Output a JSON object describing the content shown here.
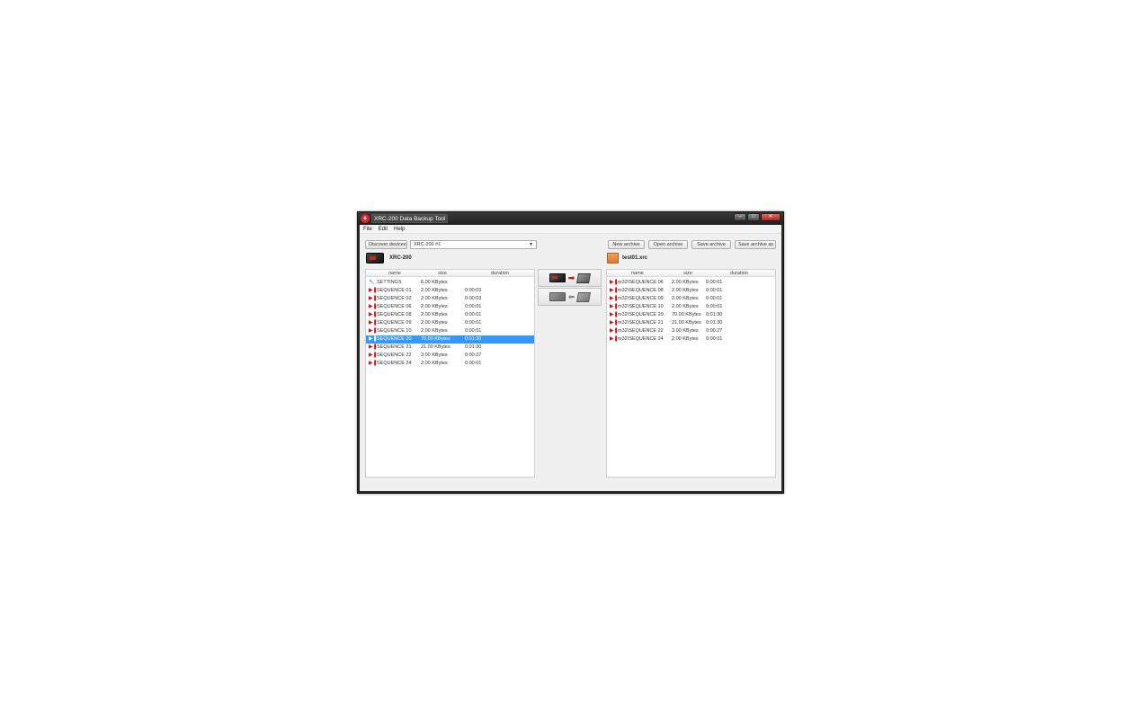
{
  "window": {
    "title": "XRC-200 Data Backup Tool",
    "controls": {
      "minimize": "–",
      "maximize": "□",
      "close": "✕"
    }
  },
  "menu": [
    "File",
    "Edit",
    "Help"
  ],
  "device": {
    "discover_label": "Discover devices",
    "selected": "XRC-200 #1",
    "header_label": "XRC-200"
  },
  "archive": {
    "buttons": [
      "New archive",
      "Open archive",
      "Save archive",
      "Save archive as"
    ],
    "header_label": "test01.xrc"
  },
  "columns": {
    "name": "name",
    "size": "size",
    "duration": "duration"
  },
  "device_rows": [
    {
      "icon": "wrench",
      "name": "SETTINGS",
      "size": "6.00 KBytes",
      "duration": ""
    },
    {
      "icon": "sequence",
      "name": "SEQUENCE 01",
      "size": "2.00 KBytes",
      "duration": "0:00:03"
    },
    {
      "icon": "sequence",
      "name": "SEQUENCE 02",
      "size": "2.00 KBytes",
      "duration": "0:00:03"
    },
    {
      "icon": "sequence",
      "name": "SEQUENCE 06",
      "size": "2.00 KBytes",
      "duration": "0:00:01"
    },
    {
      "icon": "sequence",
      "name": "SEQUENCE 08",
      "size": "2.00 KBytes",
      "duration": "0:00:01"
    },
    {
      "icon": "sequence",
      "name": "SEQUENCE 09",
      "size": "2.00 KBytes",
      "duration": "0:00:01"
    },
    {
      "icon": "sequence",
      "name": "SEQUENCE 10",
      "size": "2.00 KBytes",
      "duration": "0:00:01"
    },
    {
      "icon": "sequence",
      "name": "SEQUENCE 20",
      "size": "70.00 KBytes",
      "duration": "0:01:30",
      "selected": true
    },
    {
      "icon": "sequence",
      "name": "SEQUENCE 21",
      "size": "21.00 KBytes",
      "duration": "0:01:30"
    },
    {
      "icon": "sequence",
      "name": "SEQUENCE 22",
      "size": "3.00 KBytes",
      "duration": "0:00:27"
    },
    {
      "icon": "sequence",
      "name": "SEQUENCE 24",
      "size": "2.00 KBytes",
      "duration": "0:00:01"
    }
  ],
  "archive_rows": [
    {
      "icon": "sequence",
      "name": "m32\\SEQUENCE 06",
      "size": "2.00 KBytes",
      "duration": "0:00:01"
    },
    {
      "icon": "sequence",
      "name": "m32\\SEQUENCE 08",
      "size": "2.00 KBytes",
      "duration": "0:00:01"
    },
    {
      "icon": "sequence",
      "name": "m32\\SEQUENCE 09",
      "size": "2.00 KBytes",
      "duration": "0:00:01"
    },
    {
      "icon": "sequence",
      "name": "m32\\SEQUENCE 10",
      "size": "2.00 KBytes",
      "duration": "0:00:01"
    },
    {
      "icon": "sequence",
      "name": "m32\\SEQUENCE 20",
      "size": "70.00 KBytes",
      "duration": "0:01:30"
    },
    {
      "icon": "sequence",
      "name": "m32\\SEQUENCE 21",
      "size": "21.00 KBytes",
      "duration": "0:01:30"
    },
    {
      "icon": "sequence",
      "name": "m32\\SEQUENCE 22",
      "size": "3.00 KBytes",
      "duration": "0:00:27"
    },
    {
      "icon": "sequence",
      "name": "m32\\SEQUENCE 24",
      "size": "2.00 KBytes",
      "duration": "0:00:01"
    }
  ],
  "transfer": {
    "to_archive_icon": "device-to-computer-icon",
    "to_device_icon": "computer-to-device-icon"
  },
  "colors": {
    "selection": "#3399ff",
    "icon_red": "#c8161d",
    "close_red": "#c42b1c"
  }
}
